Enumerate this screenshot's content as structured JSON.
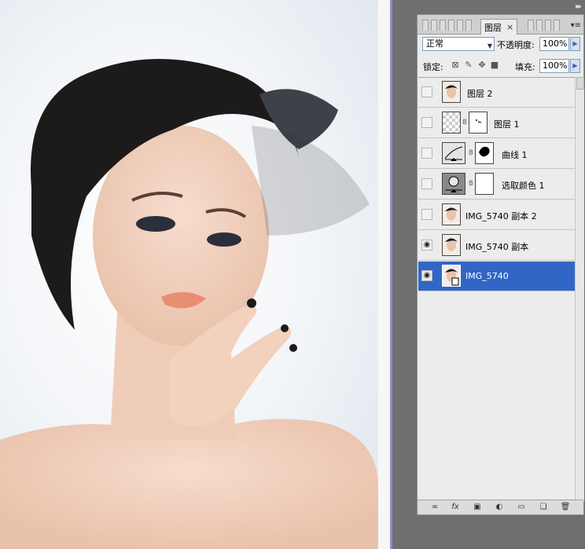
{
  "panel": {
    "tab_label": "图层",
    "tab_close": "×",
    "menu_icon": "▾≡",
    "collapse_icon": "▸▸"
  },
  "blend": {
    "mode": "正常",
    "opacity_label": "不透明度:",
    "opacity_value": "100%"
  },
  "lock": {
    "label": "锁定:",
    "fill_label": "填充:",
    "fill_value": "100%"
  },
  "layers": [
    {
      "name": "图层 2",
      "visible": false,
      "selected": false,
      "thumb": "photo"
    },
    {
      "name": "图层 1",
      "visible": false,
      "selected": false,
      "thumb": "checker",
      "mask": true
    },
    {
      "name": "曲线 1",
      "visible": false,
      "selected": false,
      "thumb": "curves",
      "mask": true
    },
    {
      "name": "选取颜色 1",
      "visible": false,
      "selected": false,
      "thumb": "selective-color",
      "mask": true
    },
    {
      "name": "IMG_5740 副本 2",
      "visible": false,
      "selected": false,
      "thumb": "photo"
    },
    {
      "name": "IMG_5740 副本",
      "visible": true,
      "selected": false,
      "thumb": "photo"
    },
    {
      "name": "IMG_5740",
      "visible": true,
      "selected": true,
      "thumb": "photo"
    }
  ],
  "bottom_icons": [
    "link-icon",
    "fx-icon",
    "mask-icon",
    "adjustment-icon",
    "folder-icon",
    "new-layer-icon",
    "trash-icon"
  ],
  "bottom_labels": {
    "fx": "fx"
  },
  "colors": {
    "selected_row": "#3266c6",
    "panel_bg": "#ececec",
    "workspace": "#6f6f6f"
  }
}
